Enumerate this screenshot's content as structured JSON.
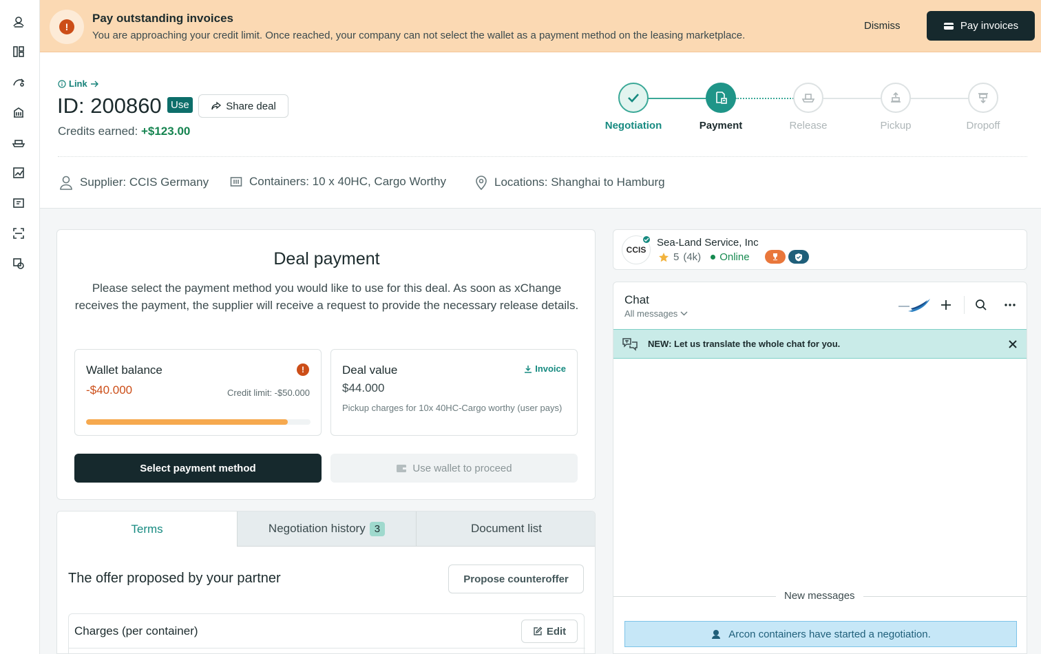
{
  "sidebar": {
    "icons": [
      "user-icon",
      "grid-icon",
      "route-icon",
      "building-icon",
      "ship-icon",
      "chart-icon",
      "map-icon",
      "scan-icon",
      "coins-icon"
    ]
  },
  "banner": {
    "title": "Pay outstanding invoices",
    "text": "You are approaching your credit limit. Once reached, your company can not select the wallet as a payment method on the leasing marketplace.",
    "dismiss_label": "Dismiss",
    "pay_label": "Pay invoices",
    "alert_glyph": "!"
  },
  "deal": {
    "link_label": "Link",
    "id_text": "ID: 200860",
    "badge": "Use",
    "share_label": "Share deal",
    "credits_label": "Credits earned:",
    "credits_value": "+$123.00",
    "supplier": "Supplier: CCIS Germany",
    "containers": "Containers: 10 x 40HC, Cargo Worthy",
    "locations": "Locations: Shanghai to Hamburg"
  },
  "steps": [
    {
      "label": "Negotiation",
      "state": "done"
    },
    {
      "label": "Payment",
      "state": "current"
    },
    {
      "label": "Release",
      "state": "upcoming"
    },
    {
      "label": "Pickup",
      "state": "upcoming"
    },
    {
      "label": "Dropoff",
      "state": "upcoming"
    }
  ],
  "payment": {
    "title": "Deal payment",
    "description": "Please select the payment method you would like to use for this deal. As soon as xChange receives the payment, the supplier will receive a request to provide the necessary release details.",
    "wallet": {
      "title": "Wallet balance",
      "balance": "-$40.000",
      "credit_limit": "Credit limit: -$50.000",
      "usage_fraction": 0.9
    },
    "deal_value": {
      "title": "Deal value",
      "invoice_label": "Invoice",
      "value": "$44.000",
      "note": "Pickup charges for 10x 40HC-Cargo worthy (user pays)"
    },
    "select_label": "Select payment method",
    "wallet_label": "Use wallet to proceed"
  },
  "tabs": {
    "items": [
      "Terms",
      "Negotiation history",
      "Document list"
    ],
    "history_count": "3",
    "offer_title": "The offer proposed by your partner",
    "counteroffer_label": "Propose counteroffer",
    "charges_label": "Charges (per container)",
    "edit_label": "Edit"
  },
  "supplier_card": {
    "logo_text": "CCIS",
    "name": "Sea-Land Service, Inc",
    "rating": "5",
    "reviews": "(4k)",
    "status": "Online"
  },
  "chat": {
    "title": "Chat",
    "filter": "All messages",
    "translate_text": "NEW: Let us translate the whole chat for you.",
    "new_messages": "New messages",
    "system_message": "Arcon containers have started a negotiation."
  },
  "colors": {
    "accent": "#168a80",
    "dark": "#16292d",
    "warning": "#cc4e18",
    "banner_bg": "#fbd9b3",
    "progress": "#f6a94f"
  }
}
